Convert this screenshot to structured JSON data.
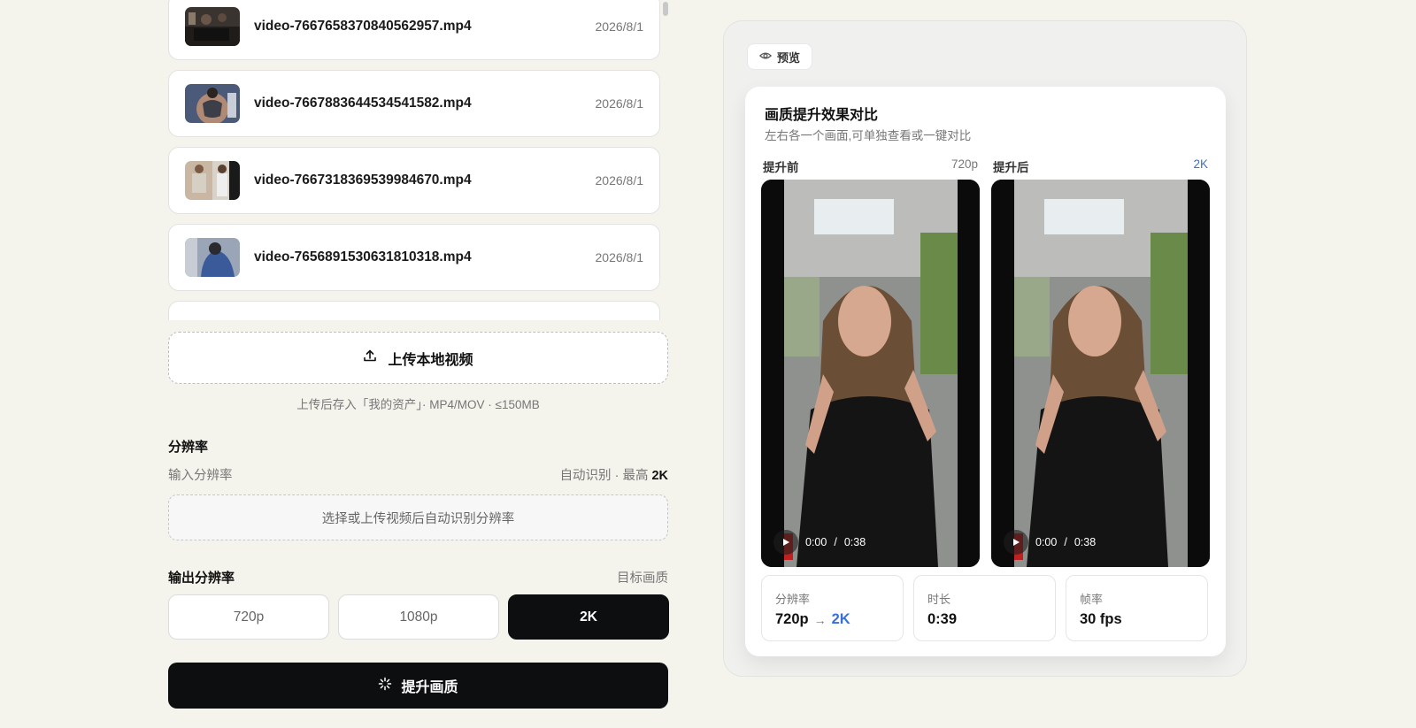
{
  "files": [
    {
      "name": "video-7667658370840562957.mp4",
      "date": "2026/8/1",
      "thumb": "dark-room"
    },
    {
      "name": "video-7667883644534541582.mp4",
      "date": "2026/8/1",
      "thumb": "tattoo"
    },
    {
      "name": "video-7667318369539984670.mp4",
      "date": "2026/8/1",
      "thumb": "split-people"
    },
    {
      "name": "video-7656891530631810318.mp4",
      "date": "2026/8/1",
      "thumb": "blue-person"
    }
  ],
  "upload": {
    "label": "上传本地视频",
    "hint": "上传后存入「我的资产」· MP4/MOV · ≤150MB",
    "icon": "upload-icon"
  },
  "resolution": {
    "title": "分辨率",
    "input_label": "输入分辨率",
    "auto_note": "自动识别 · 最高",
    "max": "2K",
    "detect_placeholder": "选择或上传视频后自动识别分辨率"
  },
  "output": {
    "title": "输出分辨率",
    "note": "目标画质",
    "options": [
      "720p",
      "1080p",
      "2K"
    ],
    "selected": "2K"
  },
  "enhance_button": "提升画质",
  "preview": {
    "chip": "预览",
    "card_title": "画质提升效果对比",
    "card_sub": "左右各一个画面,可单独查看或一键对比",
    "before": {
      "label": "提升前",
      "res": "720p",
      "time": "0:00",
      "duration": "0:38"
    },
    "after": {
      "label": "提升后",
      "res": "2K",
      "time": "0:00",
      "duration": "0:38"
    },
    "time_sep": "/",
    "stats": {
      "res_label": "分辨率",
      "res_from": "720p",
      "res_to": "2K",
      "dur_label": "时长",
      "dur_value": "0:39",
      "fps_label": "帧率",
      "fps_value": "30 fps"
    }
  },
  "colors": {
    "accent": "#3b6fd6",
    "primary": "#0c0e10",
    "background": "#f4f3ec"
  }
}
